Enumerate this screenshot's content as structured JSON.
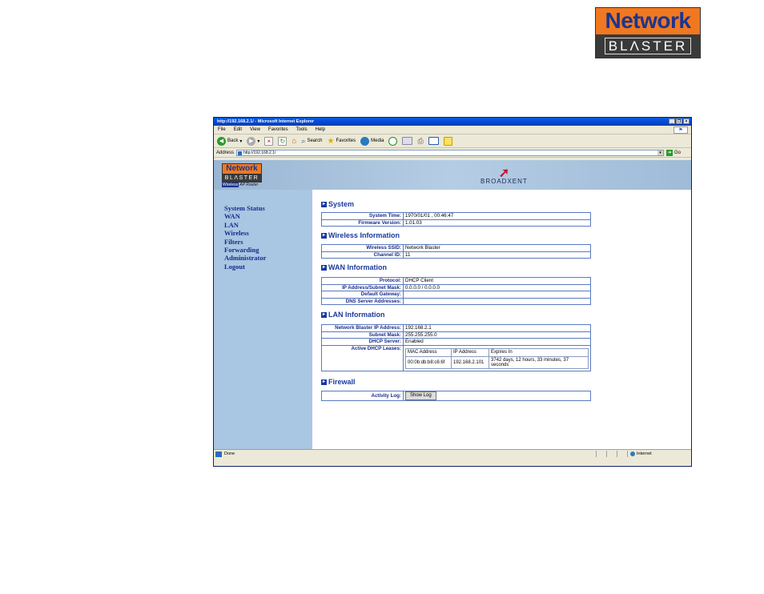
{
  "brand": {
    "line1": "Network",
    "line2": "BLΛSTER"
  },
  "browser": {
    "title": "http://192.168.2.1/ - Microsoft Internet Explorer",
    "menu": [
      "File",
      "Edit",
      "View",
      "Favorites",
      "Tools",
      "Help"
    ],
    "toolbar": {
      "back": "Back",
      "search": "Search",
      "favorites": "Favorites",
      "media": "Media"
    },
    "address_label": "Address",
    "address_value": "http://192.168.2.1/",
    "go": "Go",
    "status_text": "Done",
    "zone": "Internet"
  },
  "page": {
    "logo": {
      "line1": "Network",
      "line2": "BLΛSTER",
      "tag_a": "Wireless",
      "tag_b": "AP Router"
    },
    "partner": "BROADXENT",
    "nav": [
      "System Status",
      "WAN",
      "LAN",
      "Wireless",
      "Filters",
      "Forwarding",
      "Administrator",
      "Logout"
    ],
    "system": {
      "title": "System",
      "rows": [
        {
          "label": "System Time:",
          "value": "1970/01/01 , 00:46:47"
        },
        {
          "label": "Firmware Version:",
          "value": "1.01.03"
        }
      ]
    },
    "wireless": {
      "title": "Wireless Information",
      "rows": [
        {
          "label": "Wireless SSID:",
          "value": "Network Blaster"
        },
        {
          "label": "Channel ID:",
          "value": "11"
        }
      ]
    },
    "wan": {
      "title": "WAN Information",
      "rows": [
        {
          "label": "Protocol:",
          "value": "DHCP Client"
        },
        {
          "label": "IP Address/Subnet Mask:",
          "value": "0.0.0.0 / 0.0.0.0"
        },
        {
          "label": "Default Gateway:",
          "value": ""
        },
        {
          "label": "DNS Server Addresses:",
          "value": ""
        }
      ]
    },
    "lan": {
      "title": "LAN Information",
      "rows": [
        {
          "label": "Network Blaster IP Address:",
          "value": "192.168.2.1"
        },
        {
          "label": "Subnet Mask:",
          "value": "255.255.255.0"
        },
        {
          "label": "DHCP Server:",
          "value": "Enabled"
        }
      ],
      "leases_label": "Active DHCP Leases:",
      "leases_headers": [
        "MAC Address",
        "IP Address",
        "Expires In"
      ],
      "leases": [
        {
          "mac": "00:0b:db:b8:c6:6f",
          "ip": "192.168.2.101",
          "expires": "3742 days, 12 hours, 33 minutes, 37 seconds"
        }
      ]
    },
    "firewall": {
      "title": "Firewall",
      "label": "Activity Log:",
      "button": "Show Log"
    }
  }
}
